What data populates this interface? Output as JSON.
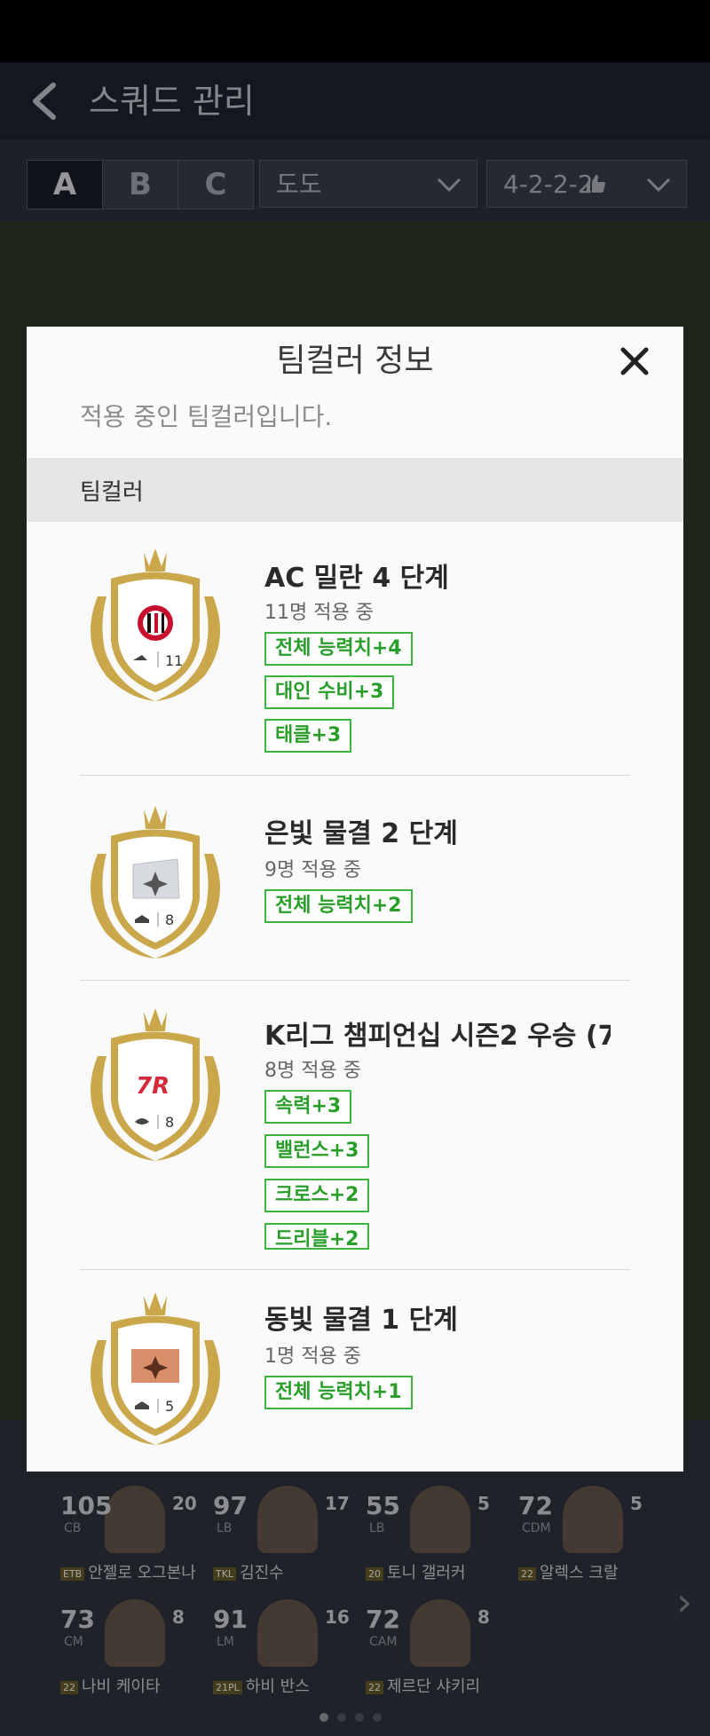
{
  "app": {
    "title": "스쿼드 관리"
  },
  "squad_tabs": [
    "A",
    "B",
    "C"
  ],
  "team_select": {
    "value": "도도"
  },
  "formation_select": {
    "value": "4-2-2-2"
  },
  "modal": {
    "title": "팀컬러 정보",
    "subtitle": "적용 중인 팀컬러입니다.",
    "section_label": "팀컬러",
    "items": [
      {
        "name": "AC 밀란 4 단계",
        "count": "11명 적용 중",
        "crest_count": "11",
        "crest_type": "club-crest",
        "tags": [
          "전체 능력치+4",
          "대인 수비+3",
          "태클+3"
        ]
      },
      {
        "name": "은빛 물결 2 단계",
        "count": "9명 적용 중",
        "crest_count": "8",
        "crest_type": "silver-card",
        "tags": [
          "전체 능력치+2"
        ]
      },
      {
        "name": "K리그 챔피언십 시즌2 우승 (7",
        "count": "8명 적용 중",
        "crest_count": "8",
        "crest_type": "kleague-crest",
        "crest_logo_text": "7R",
        "tags": [
          "속력+3",
          "밸런스+3",
          "크로스+2",
          "드리블+2"
        ]
      },
      {
        "name": "동빛 물결 1 단계",
        "count": "1명 적용 중",
        "crest_count": "5",
        "crest_type": "bronze-card",
        "tags": [
          "전체 능력치+1"
        ]
      }
    ]
  },
  "players": [
    {
      "ovr": "105",
      "pos": "CB",
      "level": "20",
      "name": "안젤로 오그본나",
      "badge": "ETB"
    },
    {
      "ovr": "97",
      "pos": "LB",
      "level": "17",
      "name": "김진수",
      "badge": "TKL"
    },
    {
      "ovr": "55",
      "pos": "LB",
      "level": "5",
      "name": "토니 갤러커",
      "badge": "20"
    },
    {
      "ovr": "72",
      "pos": "CDM",
      "level": "5",
      "name": "알렉스 크랄",
      "badge": "22"
    },
    {
      "ovr": "73",
      "pos": "CM",
      "level": "8",
      "name": "나비 케이타",
      "badge": "22"
    },
    {
      "ovr": "91",
      "pos": "LM",
      "level": "16",
      "name": "하비 반스",
      "badge": "21PL"
    },
    {
      "ovr": "72",
      "pos": "CAM",
      "level": "8",
      "name": "제르단 샤키리",
      "badge": "22"
    }
  ],
  "colors": {
    "tag_green": "#3db43d",
    "crest_gold": "#c9a74a",
    "appbar": "#1e2430"
  }
}
